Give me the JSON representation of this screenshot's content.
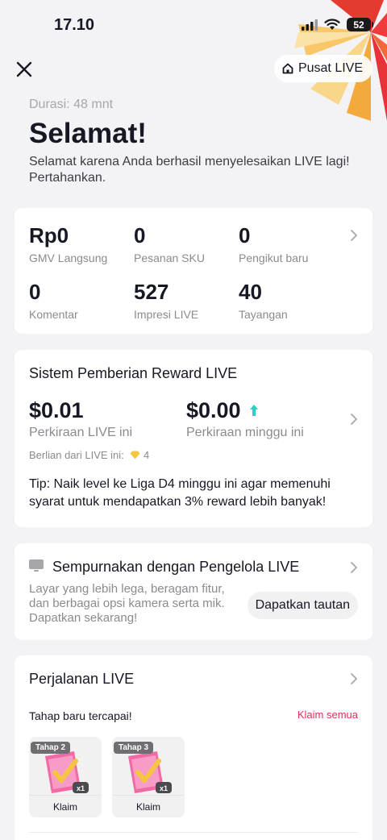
{
  "status": {
    "time": "17.10",
    "battery": "52"
  },
  "header": {
    "pusat_label": "Pusat LIVE",
    "durasi": "Durasi: 48 mnt",
    "title": "Selamat!",
    "subtitle": "Selamat karena Anda berhasil menyelesaikan LIVE lagi! Pertahankan."
  },
  "stats": [
    {
      "value": "Rp0",
      "label": "GMV Langsung"
    },
    {
      "value": "0",
      "label": "Pesanan SKU"
    },
    {
      "value": "0",
      "label": "Pengikut baru"
    },
    {
      "value": "0",
      "label": "Komentar"
    },
    {
      "value": "527",
      "label": "Impresi LIVE"
    },
    {
      "value": "40",
      "label": "Tayangan"
    }
  ],
  "reward": {
    "title": "Sistem Pemberian Reward LIVE",
    "live_value": "$0.01",
    "live_label": "Perkiraan LIVE ini",
    "week_value": "$0.00",
    "week_label": "Perkiraan minggu ini",
    "berlian_label": "Berlian dari LIVE ini:",
    "berlian_count": "4",
    "tip": "Tip: Naik level ke Liga D4 minggu ini agar memenuhi syarat untuk mendapatkan 3% reward lebih banyak!"
  },
  "pengelola": {
    "title": "Sempurnakan dengan Pengelola LIVE",
    "desc": "Layar yang lebih lega, beragam fitur, dan berbagai opsi kamera serta mik. Dapatkan sekarang!",
    "button": "Dapatkan tautan"
  },
  "journey": {
    "title": "Perjalanan LIVE",
    "subtitle": "Tahap baru tercapai!",
    "claim_all": "Klaim semua",
    "stages": [
      {
        "tag": "Tahap 2",
        "count": "x1",
        "label": "Klaim"
      },
      {
        "tag": "Tahap 3",
        "count": "x1",
        "label": "Klaim"
      }
    ]
  },
  "colors": {
    "accent": "#e02e5c",
    "teal": "#20d5c4",
    "background": "#f3f3f5"
  }
}
